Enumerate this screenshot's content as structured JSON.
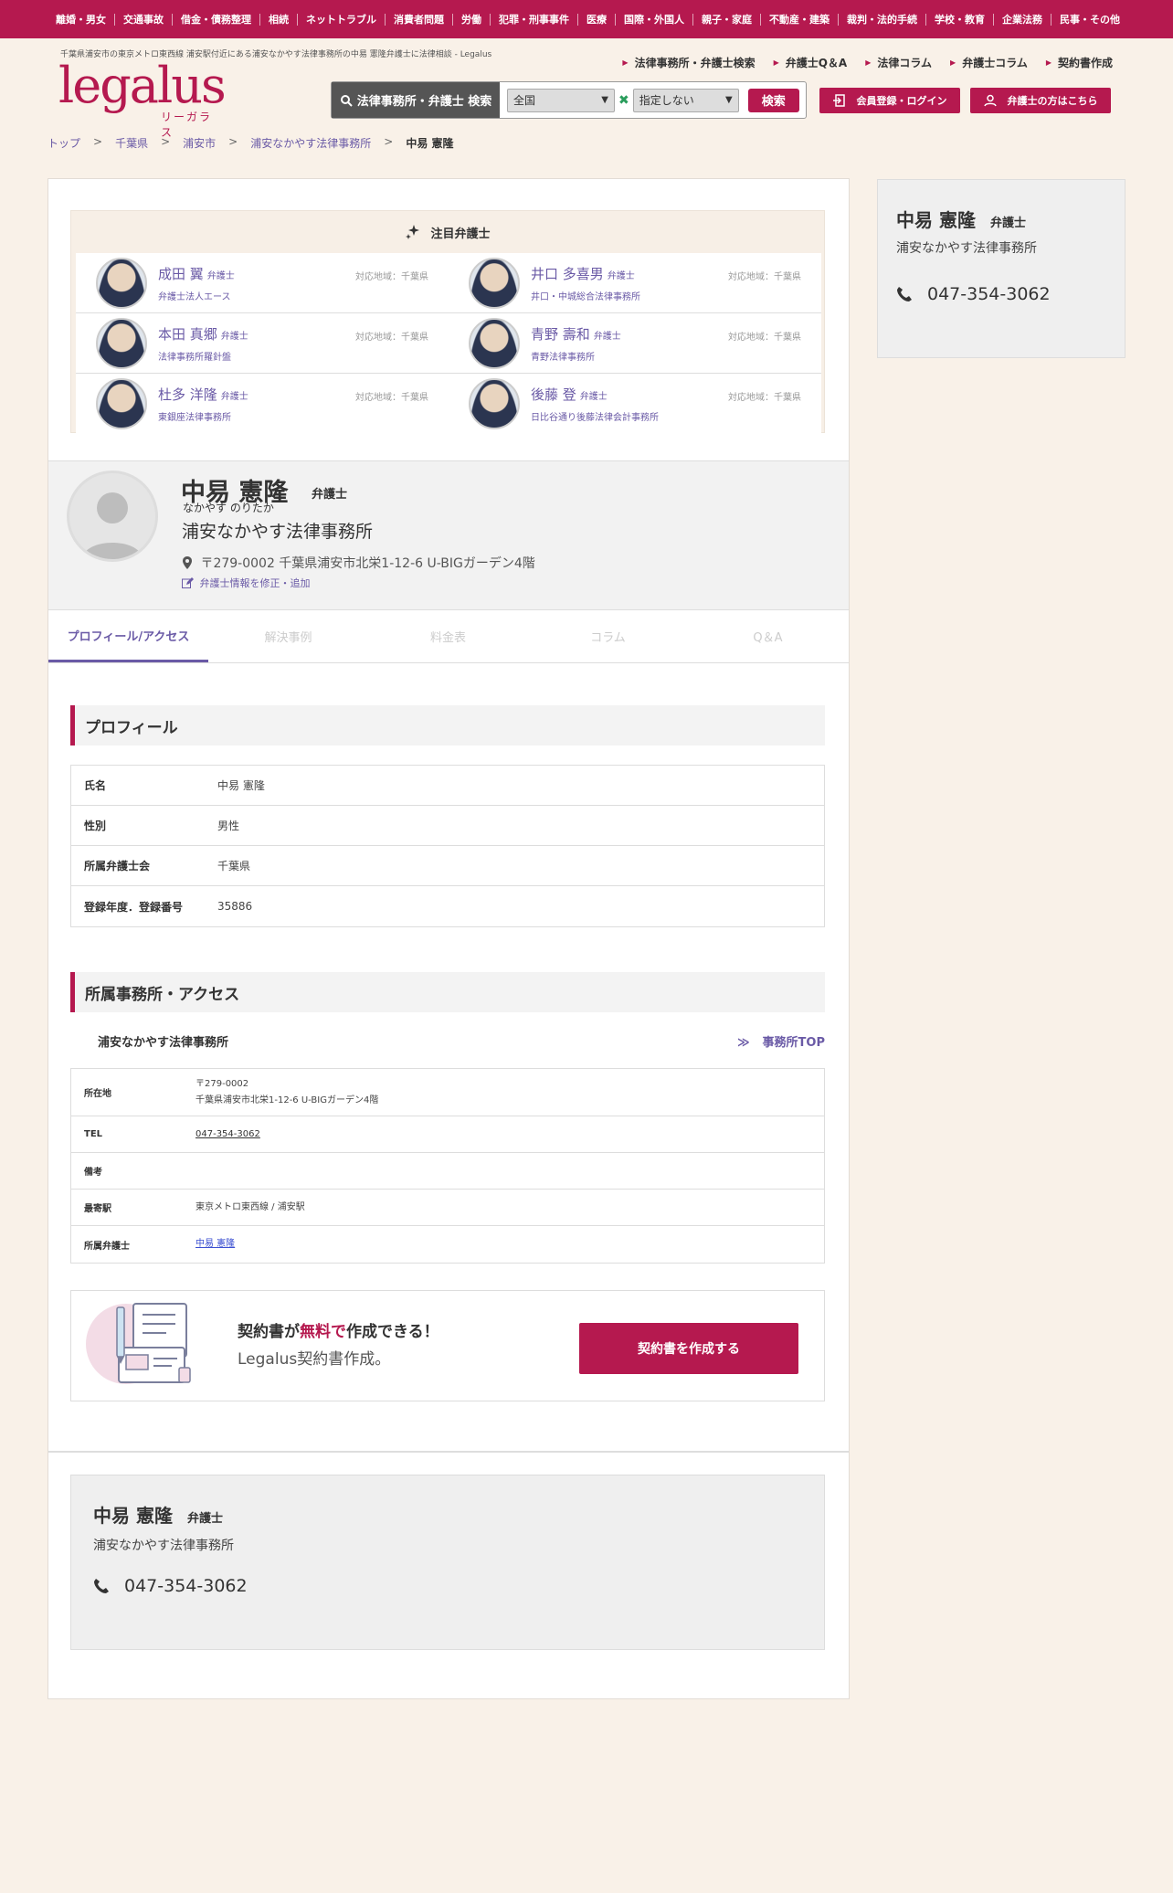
{
  "topnav": [
    "離婚・男女",
    "交通事故",
    "借金・債務整理",
    "相続",
    "ネットトラブル",
    "消費者問題",
    "労働",
    "犯罪・刑事事件",
    "医療",
    "国際・外国人",
    "親子・家庭",
    "不動産・建築",
    "裁判・法的手続",
    "学校・教育",
    "企業法務",
    "民事・その他"
  ],
  "header": {
    "tagline": "千葉県浦安市の東京メトロ東西線 浦安駅付近にある浦安なかやす法律事務所の中易 憲隆弁護士に法律相談 - Legalus",
    "logo_main": "legalus",
    "logo_kana": "リーガラス",
    "links": [
      "法律事務所・弁護士検索",
      "弁護士Q＆A",
      "法律コラム",
      "弁護士コラム",
      "契約書作成"
    ],
    "search_label": "法律事務所・弁護士 検索",
    "region_value": "全国",
    "category_value": "指定しない",
    "search_button": "検索",
    "login_button": "会員登録・ログイン",
    "lawyer_button": "弁護士の方はこちら"
  },
  "breadcrumb": {
    "items": [
      "トップ",
      "千葉県",
      "浦安市",
      "浦安なかやす法律事務所"
    ],
    "separator": ">",
    "current": "中易 憲隆"
  },
  "featured": {
    "title": "注目弁護士",
    "role": "弁護士",
    "lawyers": [
      {
        "name": "成田 翼",
        "firm": "弁護士法人エース",
        "area": "対応地域：千葉県"
      },
      {
        "name": "井口 多喜男",
        "firm": "井口・中城総合法律事務所",
        "area": "対応地域：千葉県"
      },
      {
        "name": "本田 真郷",
        "firm": "法律事務所羅針盤",
        "area": "対応地域：千葉県"
      },
      {
        "name": "青野 壽和",
        "firm": "青野法律事務所",
        "area": "対応地域：千葉県"
      },
      {
        "name": "杜多 洋隆",
        "firm": "東銀座法律事務所",
        "area": "対応地域：千葉県"
      },
      {
        "name": "後藤 登",
        "firm": "日比谷通り後藤法律会計事務所",
        "area": "対応地域：千葉県"
      }
    ]
  },
  "profile": {
    "name": "中易 憲隆",
    "role": "弁護士",
    "kana": "なかやす のりたか",
    "firm": "浦安なかやす法律事務所",
    "address": "〒279-0002 千葉県浦安市北栄1-12-6 U-BIGガーデン4階",
    "edit_link": "弁護士情報を修正・追加",
    "phone": "047-354-3062"
  },
  "tabs": [
    "プロフィール/アクセス",
    "解決事例",
    "料金表",
    "コラム",
    "Q＆A"
  ],
  "profile_section": {
    "title": "プロフィール",
    "rows": [
      {
        "key": "氏名",
        "value": "中易 憲隆"
      },
      {
        "key": "性別",
        "value": "男性"
      },
      {
        "key": "所属弁護士会",
        "value": "千葉県"
      },
      {
        "key": "登録年度．登録番号",
        "value": "35886"
      }
    ]
  },
  "office_section": {
    "title": "所属事務所・アクセス",
    "firm_name": "浦安なかやす法律事務所",
    "top_link": "事務所TOP",
    "rows": [
      {
        "key": "所在地",
        "value": "〒279-0002",
        "value2": "千葉県浦安市北栄1-12-6 U-BIGガーデン4階"
      },
      {
        "key": "TEL",
        "value": "047-354-3062"
      },
      {
        "key": "備考",
        "value": ""
      },
      {
        "key": "最寄駅",
        "value": "東京メトロ東西線 / 浦安駅"
      },
      {
        "key": "所属弁護士",
        "value": "中易 憲隆"
      }
    ]
  },
  "cta": {
    "line1_a": "契約書が",
    "line1_free": "無料で",
    "line1_b": "作成できる！",
    "line2": "Legalus契約書作成。",
    "button": "契約書を作成する"
  },
  "colors": {
    "brand": "#b5194f",
    "link": "#6a5aa6",
    "background": "#f9f1e8"
  }
}
